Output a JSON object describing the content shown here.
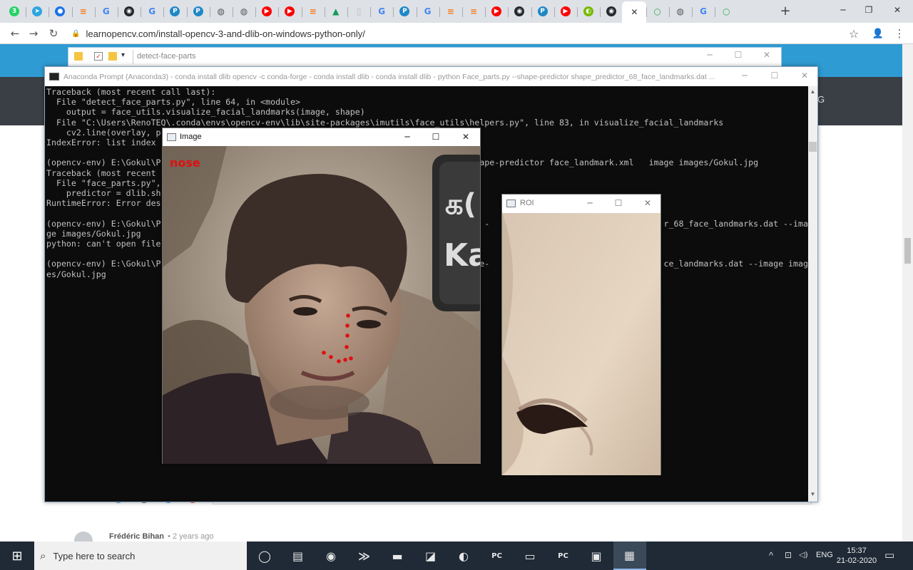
{
  "browser": {
    "tabs": [
      {
        "icon": "whatsapp-icon",
        "glyph": "3",
        "color": "#25d366"
      },
      {
        "icon": "telegram-icon",
        "glyph": "➤",
        "color": "#2ca5e0"
      },
      {
        "icon": "circle-dot-icon",
        "glyph": "●",
        "color": "#1a73e8"
      },
      {
        "icon": "stackoverflow-icon",
        "glyph": "≡",
        "color": "#f48024"
      },
      {
        "icon": "google-icon",
        "glyph": "G",
        "color": "#4285f4"
      },
      {
        "icon": "github-icon",
        "glyph": "◉",
        "color": "#24292e"
      },
      {
        "icon": "google-icon",
        "glyph": "G",
        "color": "#4285f4"
      },
      {
        "icon": "p-icon",
        "glyph": "P",
        "color": "#1e88c7"
      },
      {
        "icon": "p-icon",
        "glyph": "P",
        "color": "#1e88c7"
      },
      {
        "icon": "globe-icon",
        "glyph": "◍",
        "color": "#555555"
      },
      {
        "icon": "globe-icon",
        "glyph": "◍",
        "color": "#555555"
      },
      {
        "icon": "youtube-icon",
        "glyph": "▶",
        "color": "#ff0000"
      },
      {
        "icon": "youtube-icon",
        "glyph": "▶",
        "color": "#ff0000"
      },
      {
        "icon": "stackoverflow-icon",
        "glyph": "≡",
        "color": "#f48024"
      },
      {
        "icon": "drive-icon",
        "glyph": "▲",
        "color": "#0f9d58"
      },
      {
        "icon": "blank-page-icon",
        "glyph": "▯",
        "color": "#bbbbbb"
      },
      {
        "icon": "google-icon",
        "glyph": "G",
        "color": "#4285f4"
      },
      {
        "icon": "p-icon",
        "glyph": "P",
        "color": "#1e88c7"
      },
      {
        "icon": "google-icon",
        "glyph": "G",
        "color": "#4285f4"
      },
      {
        "icon": "stackoverflow-icon",
        "glyph": "≡",
        "color": "#f48024"
      },
      {
        "icon": "stackoverflow-icon",
        "glyph": "≡",
        "color": "#f48024"
      },
      {
        "icon": "youtube-icon",
        "glyph": "▶",
        "color": "#ff0000"
      },
      {
        "icon": "github-icon",
        "glyph": "◉",
        "color": "#24292e"
      },
      {
        "icon": "p-icon",
        "glyph": "P",
        "color": "#1e88c7"
      },
      {
        "icon": "youtube-icon",
        "glyph": "▶",
        "color": "#ff0000"
      },
      {
        "icon": "nvidia-icon",
        "glyph": "◐",
        "color": "#76b900"
      },
      {
        "icon": "github-icon",
        "glyph": "◉",
        "color": "#24292e"
      },
      {
        "icon": "close-tab-icon",
        "glyph": "✕",
        "color": "#333333"
      },
      {
        "icon": "loading-icon",
        "glyph": "○",
        "color": "#34a853"
      },
      {
        "icon": "globe-icon",
        "glyph": "◍",
        "color": "#555555"
      },
      {
        "icon": "google-icon",
        "glyph": "G",
        "color": "#4285f4"
      },
      {
        "icon": "loading-icon",
        "glyph": "○",
        "color": "#34a853"
      }
    ],
    "new_tab_glyph": "+",
    "url": "learnopencv.com/install-opencv-3-and-dlib-on-windows-python-only/",
    "window_controls": {
      "minimize": "─",
      "maximize": "❐",
      "close": "✕"
    },
    "nav": {
      "back": "←",
      "forward": "→",
      "reload": "↻",
      "lock": "🔒",
      "star": "☆",
      "account": "👤",
      "menu": "⋮"
    }
  },
  "page": {
    "comment_author": "Frédéric Bihan",
    "comment_time": "• 2 years ago",
    "header_letter": "G"
  },
  "explorer": {
    "title": "detect-face-parts",
    "controls": {
      "minimize": "─",
      "maximize": "☐",
      "close": "✕"
    }
  },
  "console": {
    "title": "Anaconda Prompt (Anaconda3) - conda  install dlib opencv -c conda-forge - conda  install dlib - conda  install dlib - python  Face_parts.py --shape-predictor shape_predictor_68_face_landmarks.dat ...",
    "controls": {
      "minimize": "─",
      "maximize": "☐",
      "close": "✕"
    },
    "lines": [
      "Traceback (most recent call last):",
      "  File \"detect_face_parts.py\", line 64, in <module>",
      "    output = face_utils.visualize_facial_landmarks(image, shape)",
      "  File \"C:\\Users\\RenoTEQ\\.conda\\envs\\opencv-env\\lib\\site-packages\\imutils\\face_utils\\helpers.py\", line 83, in visualize_facial_landmarks",
      "    cv2.line(overlay, p",
      "IndexError: list index",
      "",
      "(opencv-env) E:\\Gokul\\P                                                                ape-predictor face_landmark.xml   image images/Gokul.jpg",
      "Traceback (most recent",
      "  File \"face_parts.py\",",
      "    predictor = dlib.sh",
      "RuntimeError: Error des",
      "",
      "(opencv-env) E:\\Gokul\\P                                                              py -                                   r_68_face_landmarks.dat --ima",
      "ge images/Gokul.jpg",
      "python: can't open file",
      "",
      "(opencv-env) E:\\Gokul\\P                                                              ape-                                   ce_landmarks.dat --image imag",
      "es/Gokul.jpg"
    ]
  },
  "image_window": {
    "title": "Image",
    "overlay_label": "nose",
    "sign_text_1": "க(",
    "sign_text_2": "Ka",
    "controls": {
      "minimize": "─",
      "maximize": "☐",
      "close": "✕"
    }
  },
  "roi_window": {
    "title": "ROI",
    "controls": {
      "minimize": "─",
      "maximize": "☐",
      "close": "✕"
    }
  },
  "taskbar": {
    "search_placeholder": "Type here to search",
    "apps": [
      {
        "name": "task-view-icon",
        "glyph": "◯"
      },
      {
        "name": "multitask-icon",
        "glyph": "▤"
      },
      {
        "name": "chrome-icon",
        "glyph": "◉"
      },
      {
        "name": "powershell-icon",
        "glyph": "≫"
      },
      {
        "name": "cmd-icon",
        "glyph": "▬"
      },
      {
        "name": "notepad-icon",
        "glyph": "◪"
      },
      {
        "name": "paint-icon",
        "glyph": "◐"
      },
      {
        "name": "pycharm-icon",
        "glyph": "PC"
      },
      {
        "name": "file-explorer-icon",
        "glyph": "▭"
      },
      {
        "name": "pycharm-icon",
        "glyph": "PC"
      },
      {
        "name": "remote-desktop-icon",
        "glyph": "▣"
      },
      {
        "name": "python-window-icon",
        "glyph": "▦"
      }
    ],
    "tray": {
      "chevron": "^",
      "network": "⊡",
      "volume": "◁)",
      "lang": "ENG"
    },
    "time": "15:37",
    "date": "21-02-2020",
    "start_glyph": "⊞",
    "notification_glyph": "▭"
  }
}
